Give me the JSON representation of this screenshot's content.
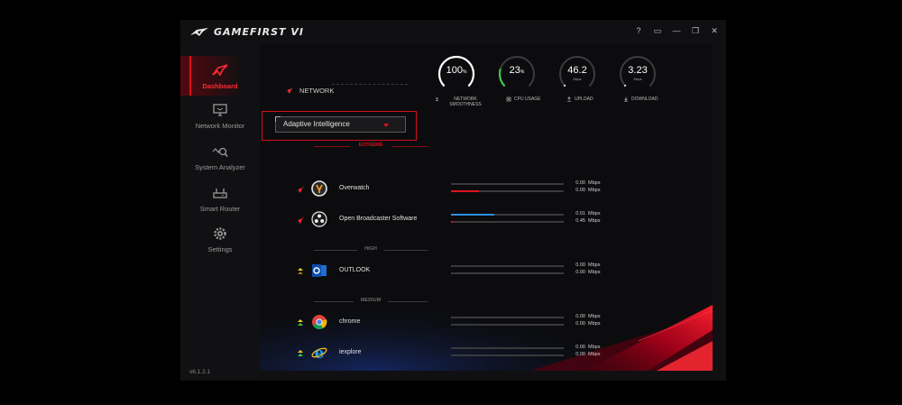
{
  "app": {
    "title": "GAMEFIRST VI",
    "version": "v6.1.2.1",
    "window_controls": {
      "help": "?",
      "miniview": "▭",
      "minimize": "—",
      "restore": "❐",
      "close": "✕"
    }
  },
  "sidebar": {
    "items": [
      {
        "label": "Dashboard",
        "icon": "dashboard-icon",
        "active": true
      },
      {
        "label": "Network Monitor",
        "icon": "monitor-icon",
        "active": false
      },
      {
        "label": "System Analyzer",
        "icon": "analyzer-icon",
        "active": false
      },
      {
        "label": "Smart Router",
        "icon": "router-icon",
        "active": false
      },
      {
        "label": "Settings",
        "icon": "gear-icon",
        "active": false
      }
    ]
  },
  "network_header": {
    "label": "NETWORK"
  },
  "gauges": [
    {
      "value": "100",
      "unit": "%",
      "sub": "",
      "label": "NETWORK SMOOTHNESS",
      "icon": "network-smoothness-icon",
      "level": 1.0,
      "color": "#ffffff"
    },
    {
      "value": "23",
      "unit": "%",
      "sub": "",
      "label": "CPU USAGE",
      "icon": "cpu-icon",
      "level": 0.23,
      "color": "#3cc94a"
    },
    {
      "value": "46.2",
      "unit": "",
      "sub": "Kbps",
      "label": "UPLOAD",
      "icon": "upload-icon",
      "level": 0.0,
      "color": "#ffffff"
    },
    {
      "value": "3.23",
      "unit": "",
      "sub": "Kbps",
      "label": "DOWNLOAD",
      "icon": "download-icon",
      "level": 0.0,
      "color": "#ffffff"
    }
  ],
  "mode_select": {
    "value": "Adaptive Intelligence"
  },
  "sections": [
    {
      "label": "EXTREME",
      "color": "#d8101c"
    },
    {
      "label": "HIGH",
      "color": "#6a6a6a"
    },
    {
      "label": "MEDIUM",
      "color": "#6a6a6a"
    }
  ],
  "apps": [
    {
      "name": "Overwatch",
      "priority": "extreme",
      "icon": "overwatch-icon",
      "upload": "0.00",
      "download": "0.00",
      "unit": "Mbps",
      "upload_fill": 0.0,
      "download_fill": 0.25,
      "download_color": "#e0121e",
      "upload_color": "#2a8fe0"
    },
    {
      "name": "Open Broadcaster Software",
      "priority": "extreme",
      "icon": "obs-icon",
      "upload": "0.01",
      "download": "0.45",
      "unit": "Mbps",
      "upload_fill": 0.38,
      "download_fill": 0.0,
      "download_color": "#e0121e",
      "upload_color": "#2a8fe0"
    },
    {
      "name": "OUTLOOK",
      "priority": "high",
      "icon": "outlook-icon",
      "upload": "0.00",
      "download": "0.00",
      "unit": "Mbps",
      "upload_fill": 0.0,
      "download_fill": 0.0,
      "download_color": "#e0121e",
      "upload_color": "#2a8fe0"
    },
    {
      "name": "chrome",
      "priority": "medium",
      "icon": "chrome-icon",
      "upload": "0.00",
      "download": "0.00",
      "unit": "Mbps",
      "upload_fill": 0.0,
      "download_fill": 0.0,
      "download_color": "#e0121e",
      "upload_color": "#2a8fe0"
    },
    {
      "name": "iexplore",
      "priority": "medium",
      "icon": "ie-icon",
      "upload": "0.00",
      "download": "0.00",
      "unit": "Mbps",
      "upload_fill": 0.0,
      "download_fill": 0.0,
      "download_color": "#e0121e",
      "upload_color": "#2a8fe0"
    }
  ]
}
